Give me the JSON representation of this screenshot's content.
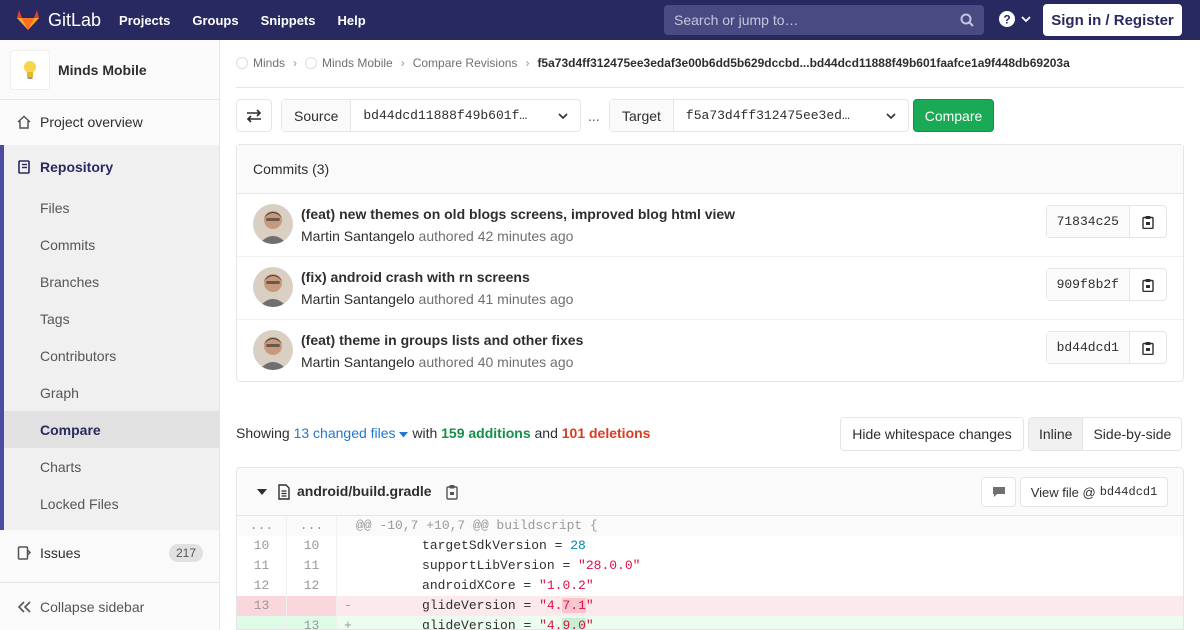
{
  "navbar": {
    "brand": "GitLab",
    "links": [
      "Projects",
      "Groups",
      "Snippets",
      "Help"
    ],
    "search_placeholder": "Search or jump to…",
    "signin": "Sign in / Register"
  },
  "sidebar": {
    "project_name": "Minds Mobile",
    "overview": "Project overview",
    "repository": "Repository",
    "repo_items": [
      "Files",
      "Commits",
      "Branches",
      "Tags",
      "Contributors",
      "Graph",
      "Compare",
      "Charts",
      "Locked Files"
    ],
    "active_item": "Compare",
    "issues": "Issues",
    "issues_count": "217",
    "collapse": "Collapse sidebar"
  },
  "breadcrumb": {
    "items": [
      "Minds",
      "Minds Mobile",
      "Compare Revisions"
    ],
    "current": "f5a73d4ff312475ee3edaf3e00b6dd5b629dccbd...bd44dcd11888f49b601faafce1a9f448db69203a"
  },
  "compare": {
    "source_label": "Source",
    "source_value": "bd44dcd11888f49b601f…",
    "dots": "...",
    "target_label": "Target",
    "target_value": "f5a73d4ff312475ee3ed…",
    "button": "Compare"
  },
  "commits": {
    "header": "Commits (3)",
    "items": [
      {
        "title": "(feat) new themes on old blogs screens, improved blog html view",
        "author": "Martin Santangelo",
        "meta": "authored 42 minutes ago",
        "sha": "71834c25"
      },
      {
        "title": "(fix) android crash with rn screens",
        "author": "Martin Santangelo",
        "meta": "authored 41 minutes ago",
        "sha": "909f8b2f"
      },
      {
        "title": "(feat) theme in groups lists and other fixes",
        "author": "Martin Santangelo",
        "meta": "authored 40 minutes ago",
        "sha": "bd44dcd1"
      }
    ]
  },
  "summary": {
    "showing": "Showing",
    "changed_files": "13 changed files",
    "with": "with",
    "additions": "159 additions",
    "and": "and",
    "deletions": "101 deletions",
    "whitespace_button": "Hide whitespace changes",
    "inline": "Inline",
    "side_by_side": "Side-by-side"
  },
  "diff": {
    "filename": "android/build.gradle",
    "view_file_label": "View file @",
    "view_file_sha": "bd44dcd1",
    "hunk_old": "...",
    "hunk_new": "...",
    "hunk_header": "@@ -10,7 +10,7 @@ buildscript {",
    "lines": [
      {
        "old": "10",
        "new": "10",
        "key": "        targetSdkVersion = ",
        "value": "28"
      },
      {
        "old": "11",
        "new": "11",
        "key": "        supportLibVersion = ",
        "value": "\"28.0.0\""
      },
      {
        "old": "12",
        "new": "12",
        "key": "        androidXCore = ",
        "value": "\"1.0.2\""
      }
    ],
    "removed": {
      "old": "13",
      "sign": "-",
      "key": "        glideVersion = ",
      "pre": "\"4.",
      "changed": "7.1",
      "post": "\""
    },
    "added": {
      "new": "13",
      "sign": "+",
      "key": "        glideVersion = ",
      "pre": "\"4.",
      "changed": "9.0",
      "post": "\""
    }
  },
  "colors": {
    "navbar": "#292961",
    "accent": "#4b4ba3",
    "compare_button": "#1aaa55",
    "additions": "#168f48",
    "deletions": "#db3b21",
    "link": "#1f78d1"
  }
}
